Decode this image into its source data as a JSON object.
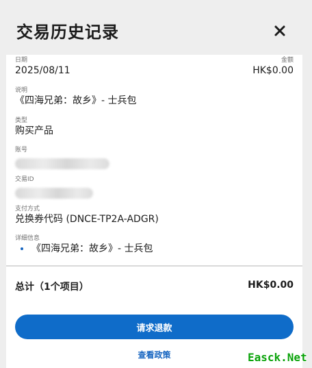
{
  "header": {
    "title": "交易历史记录",
    "close_label": "关闭"
  },
  "fields": {
    "date": {
      "label": "日期",
      "value": "2025/08/11"
    },
    "amount": {
      "label": "金额",
      "value": "HK$0.00"
    },
    "description": {
      "label": "说明",
      "value": "《四海兄弟：故乡》- 士兵包"
    },
    "type": {
      "label": "类型",
      "value": "购买产品"
    },
    "account": {
      "label": "账号"
    },
    "transaction_id": {
      "label": "交易ID"
    },
    "payment": {
      "label": "支付方式",
      "value": "兑换券代码 (DNCE-TP2A-ADGR)"
    },
    "details": {
      "label": "详细信息",
      "items": [
        "《四海兄弟：故乡》- 士兵包"
      ]
    }
  },
  "summary": {
    "label": "总计（1个项目）",
    "value": "HK$0.00"
  },
  "actions": {
    "refund_label": "请求退款",
    "policy_label": "查看政策"
  },
  "watermark": "Easck.Net",
  "colors": {
    "accent": "#0f6cc9",
    "link": "#1564c0",
    "watermark": "#0aa30a"
  }
}
